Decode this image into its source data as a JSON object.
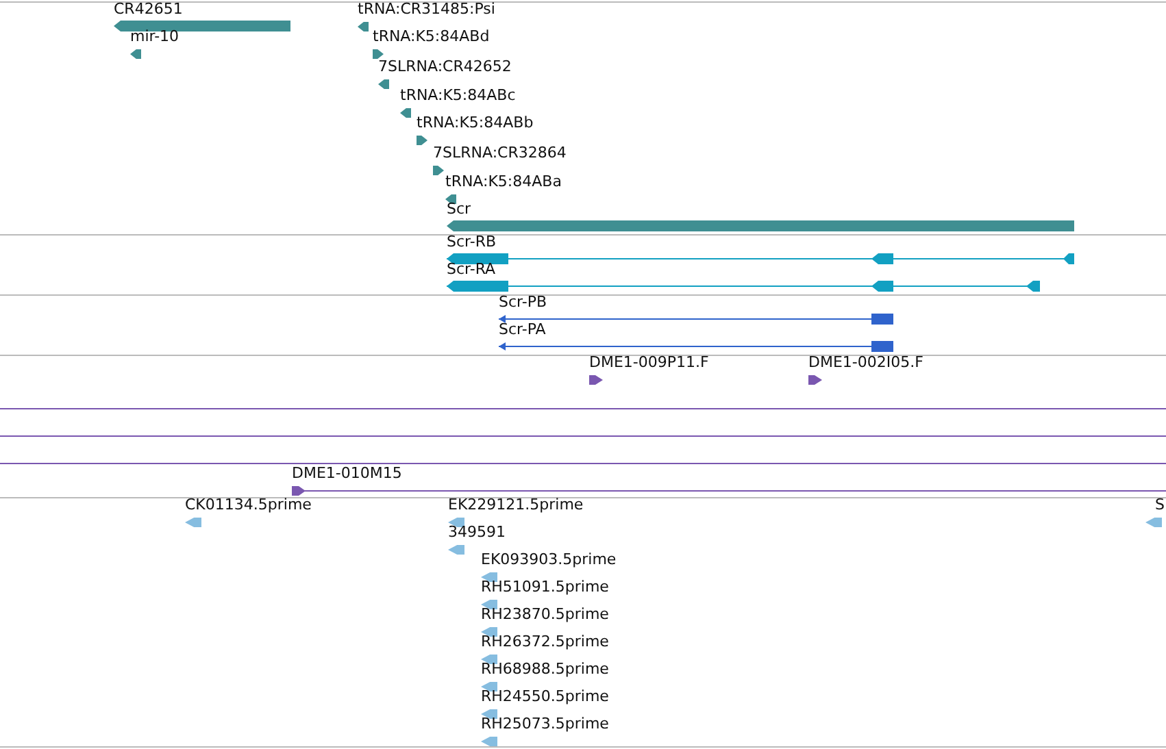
{
  "tracks": [
    {
      "color": "#3f8f92",
      "features": [
        {
          "label": "CR42651",
          "kind": "bar",
          "reverse": true
        },
        {
          "label": "mir-10",
          "kind": "marker",
          "reverse": true
        },
        {
          "label": "tRNA:CR31485:Psi",
          "kind": "marker",
          "reverse": true
        },
        {
          "label": "tRNA:K5:84ABd",
          "kind": "marker",
          "reverse": false
        },
        {
          "label": "7SLRNA:CR42652",
          "kind": "marker",
          "reverse": true
        },
        {
          "label": "tRNA:K5:84ABc",
          "kind": "marker",
          "reverse": true
        },
        {
          "label": "tRNA:K5:84ABb",
          "kind": "marker",
          "reverse": false
        },
        {
          "label": "7SLRNA:CR32864",
          "kind": "marker",
          "reverse": false
        },
        {
          "label": "tRNA:K5:84ABa",
          "kind": "marker",
          "reverse": true
        },
        {
          "label": "Scr",
          "kind": "bar",
          "reverse": true
        }
      ]
    },
    {
      "color": "#12a0c2",
      "features": [
        {
          "label": "Scr-RB",
          "kind": "transcript",
          "reverse": true
        },
        {
          "label": "Scr-RA",
          "kind": "transcript",
          "reverse": true
        }
      ]
    },
    {
      "color": "#2f63cc",
      "features": [
        {
          "label": "Scr-PB",
          "kind": "transcript",
          "reverse": true
        },
        {
          "label": "Scr-PA",
          "kind": "transcript",
          "reverse": true
        }
      ]
    },
    {
      "color": "#7a57b0",
      "features": [
        {
          "label": "DME1-009P11.F",
          "kind": "marker",
          "reverse": false
        },
        {
          "label": "DME1-002I05.F",
          "kind": "marker",
          "reverse": false
        },
        {
          "kind": "line"
        },
        {
          "kind": "line"
        },
        {
          "kind": "line"
        },
        {
          "label": "DME1-010M15",
          "kind": "span",
          "reverse": false
        }
      ]
    },
    {
      "color": "#86bde0",
      "features": [
        {
          "label": "CK01134.5prime",
          "kind": "marker",
          "reverse": true
        },
        {
          "label": "EK229121.5prime",
          "kind": "marker",
          "reverse": true
        },
        {
          "label": "349591",
          "kind": "marker",
          "reverse": true
        },
        {
          "label": "EK093903.5prime",
          "kind": "marker",
          "reverse": true
        },
        {
          "label": "RH51091.5prime",
          "kind": "marker",
          "reverse": true
        },
        {
          "label": "RH23870.5prime",
          "kind": "marker",
          "reverse": true
        },
        {
          "label": "RH26372.5prime",
          "kind": "marker",
          "reverse": true
        },
        {
          "label": "RH68988.5prime",
          "kind": "marker",
          "reverse": true
        },
        {
          "label": "RH24550.5prime",
          "kind": "marker",
          "reverse": true
        },
        {
          "label": "RH25073.5prime",
          "kind": "marker",
          "reverse": true
        },
        {
          "label": "S",
          "kind": "marker",
          "reverse": true
        }
      ]
    }
  ]
}
